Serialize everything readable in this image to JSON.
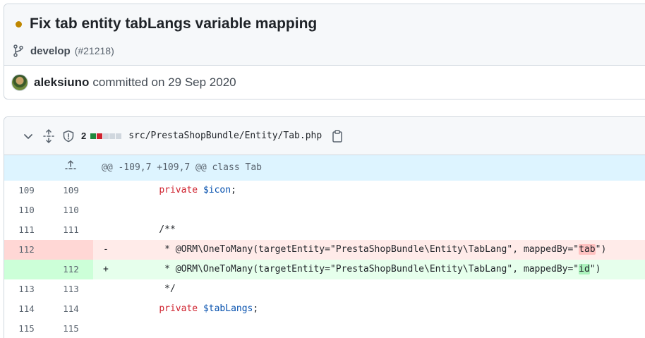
{
  "commit": {
    "title": "Fix tab entity tabLangs variable mapping",
    "status_color": "#bf8700",
    "branch": "develop",
    "pr": "(#21218)",
    "author": "aleksiuno",
    "meta": "committed on 29 Sep 2020"
  },
  "file": {
    "change_count": "2",
    "diffstat_colors": [
      "#1f883d",
      "#cf222e",
      "#d0d7de",
      "#d0d7de",
      "#d0d7de"
    ],
    "path": "src/PrestaShopBundle/Entity/Tab.php",
    "icons": [
      "chevron-down-icon",
      "unfold-icon",
      "shield-icon",
      "copy-icon"
    ]
  },
  "diff": {
    "hunk": "@@ -109,7 +109,7 @@ class Tab",
    "rows": [
      {
        "old": "109",
        "new": "109",
        "type": "ctx",
        "indent": "    ",
        "kw": "private",
        "var": "$icon",
        "rest": ";"
      },
      {
        "old": "110",
        "new": "110",
        "type": "ctx",
        "text": ""
      },
      {
        "old": "111",
        "new": "111",
        "type": "ctx",
        "text": "    /**"
      },
      {
        "old": "112",
        "new": "",
        "type": "del",
        "marker": "-",
        "pre": "     * @ORM\\OneToMany(targetEntity=\"PrestaShopBundle\\Entity\\TabLang\", mappedBy=\"",
        "hl": "tab",
        "post": "\")"
      },
      {
        "old": "",
        "new": "112",
        "type": "add",
        "marker": "+",
        "pre": "     * @ORM\\OneToMany(targetEntity=\"PrestaShopBundle\\Entity\\TabLang\", mappedBy=\"",
        "hl": "id",
        "post": "\")"
      },
      {
        "old": "113",
        "new": "113",
        "type": "ctx",
        "text": "     */"
      },
      {
        "old": "114",
        "new": "114",
        "type": "ctx",
        "indent": "    ",
        "kw": "private",
        "var": "$tabLangs",
        "rest": ";"
      },
      {
        "old": "115",
        "new": "115",
        "type": "ctx",
        "text": ""
      }
    ]
  }
}
